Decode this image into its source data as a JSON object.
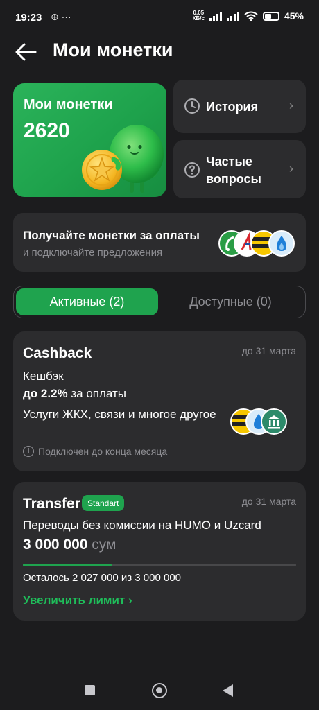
{
  "status_bar": {
    "time": "19:23",
    "extra_icons": "⊕ ···",
    "speed_value": "0,05",
    "speed_unit": "КБ/с",
    "battery": "45%"
  },
  "header": {
    "title": "Мои монетки"
  },
  "coins": {
    "label": "Мои монетки",
    "value": "2620"
  },
  "history": {
    "label": "История"
  },
  "faq": {
    "label_line1": "Частые",
    "label_line2": "вопросы"
  },
  "promo": {
    "title": "Получайте монетки за оплаты",
    "subtitle": "и подключайте предложения"
  },
  "tabs": [
    {
      "label": "Активные (2)",
      "active": true
    },
    {
      "label": "Доступные (0)",
      "active": false
    }
  ],
  "cashback": {
    "title": "Cashback",
    "date": "до 31 марта",
    "line1": "Кешбэк",
    "percent": "до 2.2%",
    "percent_suffix": " за оплаты",
    "services": "Услуги ЖКХ, связи и многое другое",
    "note": "Подключен до конца месяца"
  },
  "transfer": {
    "title": "Transfer",
    "badge": "Standart",
    "date": "до 31 марта",
    "description": "Переводы без комиссии на HUMO и Uzcard",
    "amount": "3 000 000",
    "currency": " сум",
    "progress_fraction": 0.3243,
    "remaining": "Осталось 2 027 000 из 3 000 000",
    "link": "Увеличить лимит"
  },
  "colors": {
    "accent": "#1fa34e",
    "background": "#1c1c1e",
    "card": "#2c2c2e"
  }
}
